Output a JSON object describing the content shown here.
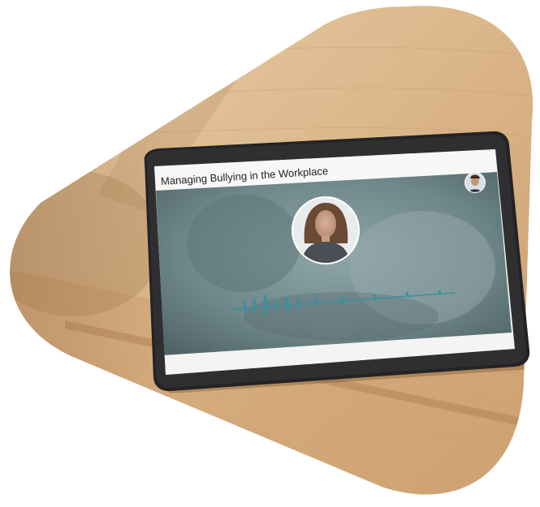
{
  "scene": {
    "description_free": true,
    "colors": {
      "wood_light": "#e8c9a0",
      "wood_mid": "#d8b080",
      "wood_dark": "#b88455",
      "tablet_frame": "#2a2a2c",
      "screen_header": "#f6f6f6",
      "video_bg": "#7c9496",
      "waveform": "#3f8ea0"
    }
  },
  "tablet": {
    "title": "Managing Bullying in the Workplace",
    "presenter_avatar": "person-avatar",
    "user_avatar": "person-avatar"
  }
}
